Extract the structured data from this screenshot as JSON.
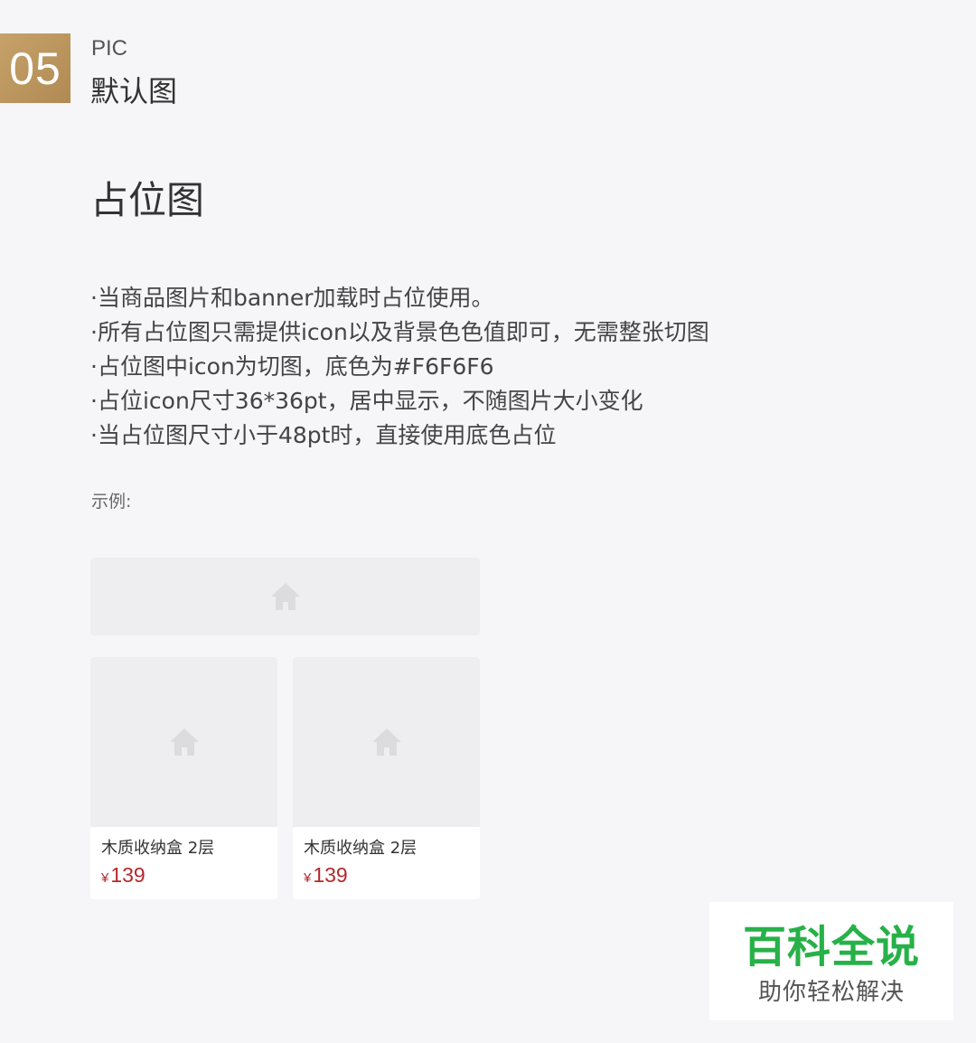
{
  "header": {
    "badge_number": "05",
    "subtitle": "PIC",
    "title": "默认图"
  },
  "heading": "占位图",
  "bullets": [
    "当商品图片和banner加载时占位使用。",
    "所有占位图只需提供icon以及背景色色值即可，无需整张切图",
    "占位图中icon为切图，底色为#F6F6F6",
    "占位icon尺寸36*36pt，居中显示，不随图片大小变化",
    "当占位图尺寸小于48pt时，直接使用底色占位"
  ],
  "example_label": "示例:",
  "banner_placeholder": {
    "icon": "home-icon"
  },
  "products": [
    {
      "name": "木质收纳盒 2层",
      "currency": "¥",
      "price": "139",
      "icon": "home-icon"
    },
    {
      "name": "木质收纳盒 2层",
      "currency": "¥",
      "price": "139",
      "icon": "home-icon"
    }
  ],
  "colors": {
    "badge": "#b8955c",
    "placeholder_bg": "#eeeef0",
    "placeholder_icon": "#dcdcde",
    "price": "#b4282d",
    "watermark_green": "#27b148"
  },
  "watermark": {
    "title": "百科全说",
    "subtitle": "助你轻松解决"
  }
}
